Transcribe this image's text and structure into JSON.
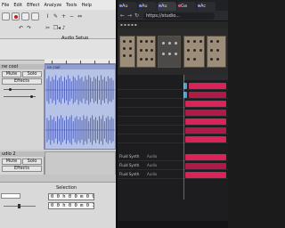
{
  "audacity": {
    "menu": [
      "File",
      "Edit",
      "Effect",
      "Analyze",
      "Tools",
      "Help"
    ],
    "toolbar": {
      "audio_setup_label": "Audio Setup"
    },
    "tracks": [
      {
        "name": "ne cool",
        "mute_label": "Mute",
        "solo_label": "Solo",
        "effects_label": "Effects",
        "clip_label": "ne cool"
      },
      {
        "name": "udio 2",
        "mute_label": "Mute",
        "solo_label": "Solo",
        "effects_label": "Effects"
      }
    ],
    "selection": {
      "label": "Selection",
      "start": "0 0 h 0 0 m 0 0 . 0 0 0 s",
      "end": "0 0 h 0 0 m 0 1 . 6 9 0 s"
    }
  },
  "browser": {
    "tabs": [
      {
        "label": "Au"
      },
      {
        "label": "Au"
      },
      {
        "label": "Au"
      },
      {
        "label": "Ga"
      },
      {
        "label": "Ac"
      }
    ],
    "url": "https://studio...",
    "daw": {
      "rows": [
        {
          "label": "",
          "sub": ""
        },
        {
          "label": "Fluid Synth",
          "sub": "Audio"
        },
        {
          "label": "Fluid Synth",
          "sub": "Audio"
        },
        {
          "label": "Fluid Synth",
          "sub": "Audio"
        }
      ]
    }
  },
  "colors": {
    "accent_pink": "#d9245a",
    "waveform_blue": "#3c4fb0",
    "clip_bg": "#b7c3e6"
  }
}
